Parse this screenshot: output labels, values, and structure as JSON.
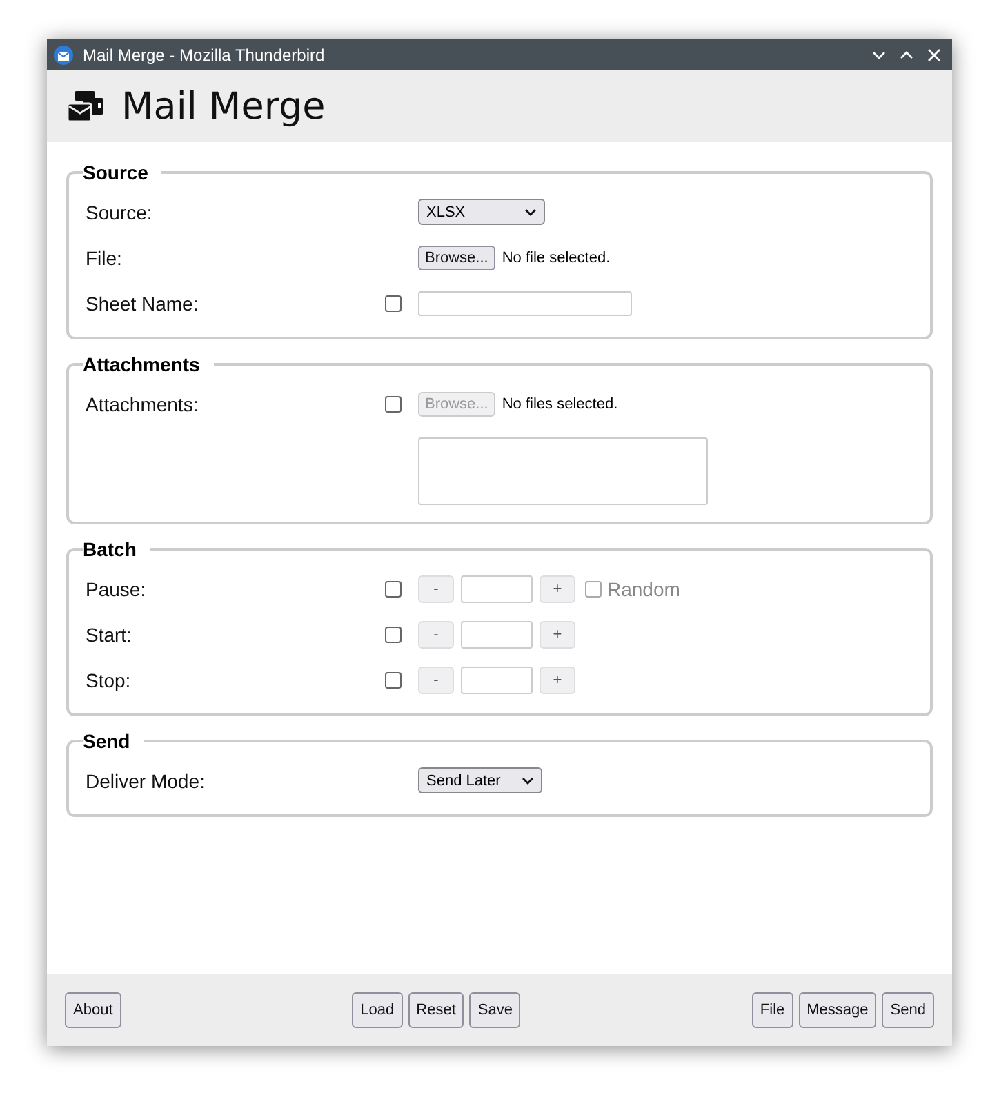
{
  "window": {
    "title": "Mail Merge - Mozilla Thunderbird"
  },
  "header": {
    "title": "Mail Merge"
  },
  "sections": [
    {
      "title": "Source",
      "rows": [
        {
          "kind": "select",
          "label": "Source:",
          "value": "XLSX"
        },
        {
          "kind": "file",
          "label": "File:",
          "button": "Browse...",
          "status": "No file selected.",
          "disabled": false
        },
        {
          "kind": "text",
          "label": "Sheet Name:",
          "checkbox": {
            "checked": false
          }
        }
      ]
    },
    {
      "title": "Attachments",
      "rows": [
        {
          "kind": "file",
          "label": "Attachments:",
          "button": "Browse...",
          "status": "No files selected.",
          "disabled": true,
          "checkbox": {
            "checked": false
          }
        },
        {
          "kind": "textarea"
        }
      ]
    },
    {
      "title": "Batch",
      "rows": [
        {
          "kind": "number",
          "label": "Pause:",
          "minus": "-",
          "plus": "+",
          "checkbox": {
            "checked": false
          },
          "extra": {
            "label": "Random",
            "checked": false,
            "disabled": true
          }
        },
        {
          "kind": "number",
          "label": "Start:",
          "minus": "-",
          "plus": "+",
          "checkbox": {
            "checked": false
          }
        },
        {
          "kind": "number",
          "label": "Stop:",
          "minus": "-",
          "plus": "+",
          "checkbox": {
            "checked": false
          }
        }
      ]
    },
    {
      "title": "Send",
      "rows": [
        {
          "kind": "select",
          "label": "Deliver Mode:",
          "value": "Send Later"
        }
      ]
    }
  ],
  "footer": {
    "left": [
      "About"
    ],
    "center": [
      "Load",
      "Reset",
      "Save"
    ],
    "right": [
      "File",
      "Message",
      "Send"
    ]
  }
}
